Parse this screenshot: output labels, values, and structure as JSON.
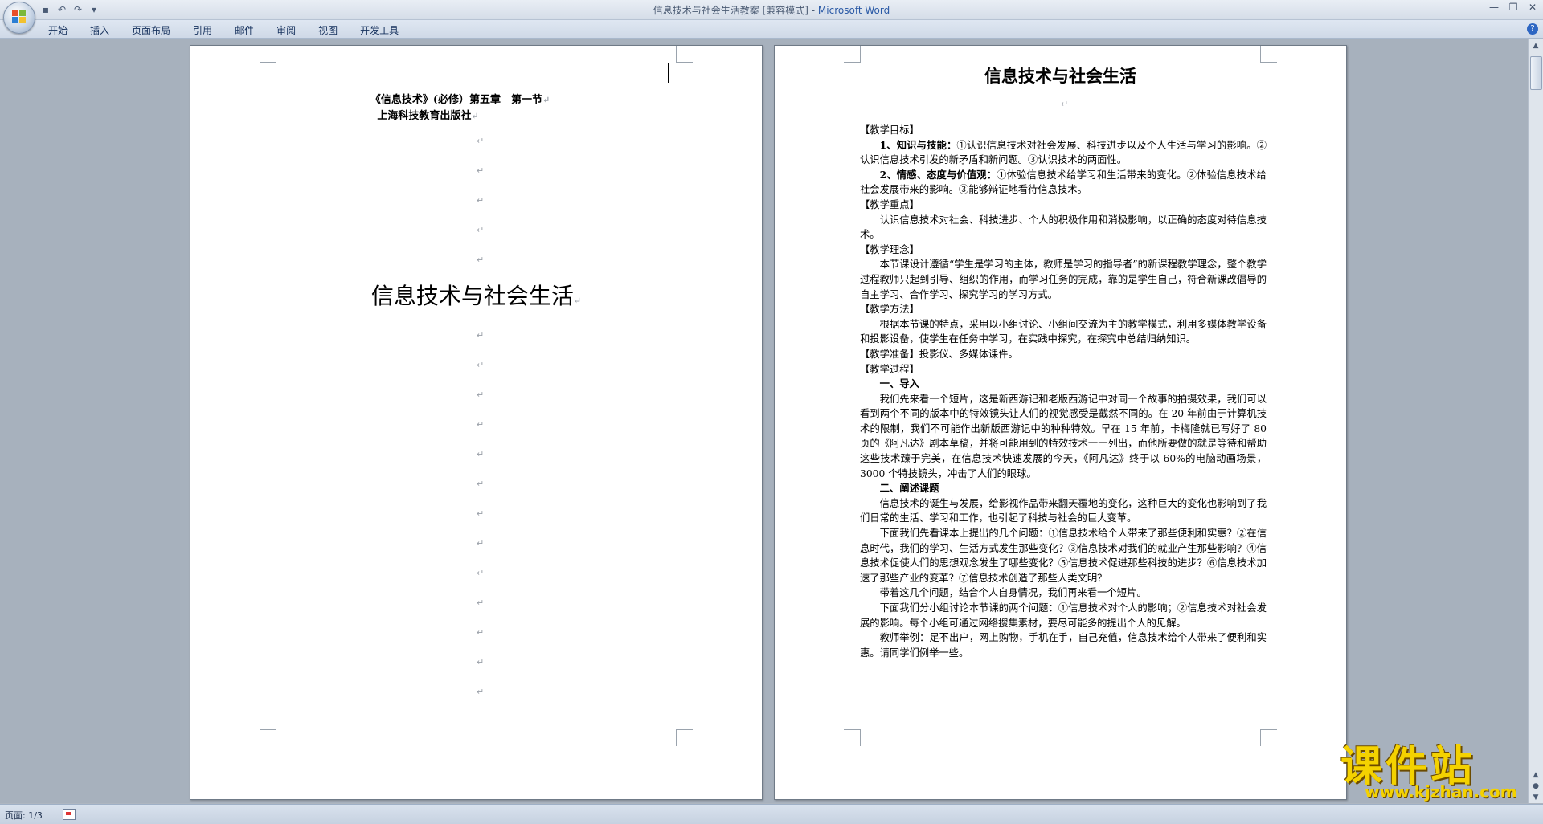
{
  "window": {
    "title": "信息技术与社会生活教案 [兼容模式] - ",
    "app_name": "Microsoft Word",
    "controls": [
      "minimize-icon",
      "restore-icon",
      "close-icon"
    ]
  },
  "quick_access": [
    "save-icon",
    "undo-icon",
    "redo-icon",
    "customize-icon"
  ],
  "ribbon": {
    "tabs": [
      "开始",
      "插入",
      "页面布局",
      "引用",
      "邮件",
      "审阅",
      "视图",
      "开发工具"
    ]
  },
  "left_page": {
    "subtitle1": "《信息技术》(必修）第五章　第一节",
    "subtitle2": "上海科技教育出版社",
    "title": "信息技术与社会生活",
    "para_mark": "↵"
  },
  "right_page": {
    "title": "信息技术与社会生活",
    "lines": {
      "h1": "【教学目标】",
      "p1_b": "1、知识与技能：",
      "p1": "①认识信息技术对社会发展、科技进步以及个人生活与学习的影响。②认识信息技术引发的新矛盾和新问题。③认识技术的两面性。",
      "p2_b": "2、情感、态度与价值观：",
      "p2": "①体验信息技术给学习和生活带来的变化。②体验信息技术给社会发展带来的影响。③能够辩证地看待信息技术。",
      "h2": "【教学重点】",
      "p3": "认识信息技术对社会、科技进步、个人的积极作用和消极影响，以正确的态度对待信息技术。",
      "h3": "【教学理念】",
      "p4": "本节课设计遵循“学生是学习的主体，教师是学习的指导者”的新课程教学理念，整个教学过程教师只起到引导、组织的作用，而学习任务的完成，靠的是学生自己，符合新课改倡导的自主学习、合作学习、探究学习的学习方式。",
      "h4": "【教学方法】",
      "p5": "根据本节课的特点，采用以小组讨论、小组间交流为主的教学模式，利用多媒体教学设备和投影设备，使学生在任务中学习，在实践中探究，在探究中总结归纳知识。",
      "h5": "【教学准备】投影仪、多媒体课件。",
      "h6": "【教学过程】",
      "s1": "一、导入",
      "p6": "我们先来看一个短片，这是新西游记和老版西游记中对同一个故事的拍摄效果，我们可以看到两个不同的版本中的特效镜头让人们的视觉感受是截然不同的。在 20 年前由于计算机技术的限制，我们不可能作出新版西游记中的种种特效。早在 15 年前，卡梅隆就已写好了 80 页的《阿凡达》剧本草稿，并将可能用到的特效技术一一列出，而他所要做的就是等待和帮助这些技术臻于完美，在信息技术快速发展的今天，《阿凡达》终于以 60%的电脑动画场景，3000 个特技镜头，冲击了人们的眼球。",
      "s2": "二、阐述课题",
      "p7": "信息技术的诞生与发展，给影视作品带来翻天覆地的变化，这种巨大的变化也影响到了我们日常的生活、学习和工作，也引起了科技与社会的巨大变革。",
      "p8": "下面我们先看课本上提出的几个问题：①信息技术给个人带来了那些便利和实惠？②在信息时代，我们的学习、生活方式发生那些变化？③信息技术对我们的就业产生那些影响？④信息技术促使人们的思想观念发生了哪些变化？⑤信息技术促进那些科技的进步？⑥信息技术加速了那些产业的变革？⑦信息技术创造了那些人类文明？",
      "p9": "带着这几个问题，结合个人自身情况，我们再来看一个短片。",
      "p10": "下面我们分小组讨论本节课的两个问题：①信息技术对个人的影响；②信息技术对社会发展的影响。每个小组可通过网络搜集素材，要尽可能多的提出个人的见解。",
      "p11": "教师举例：足不出户，网上购物，手机在手，自己充值，信息技术给个人带来了便利和实惠。请同学们例举一些。"
    }
  },
  "status_bar": {
    "page_info": "页面: 1/3"
  },
  "watermark": {
    "text": "课件站",
    "url": "www.kjzhan.com"
  }
}
